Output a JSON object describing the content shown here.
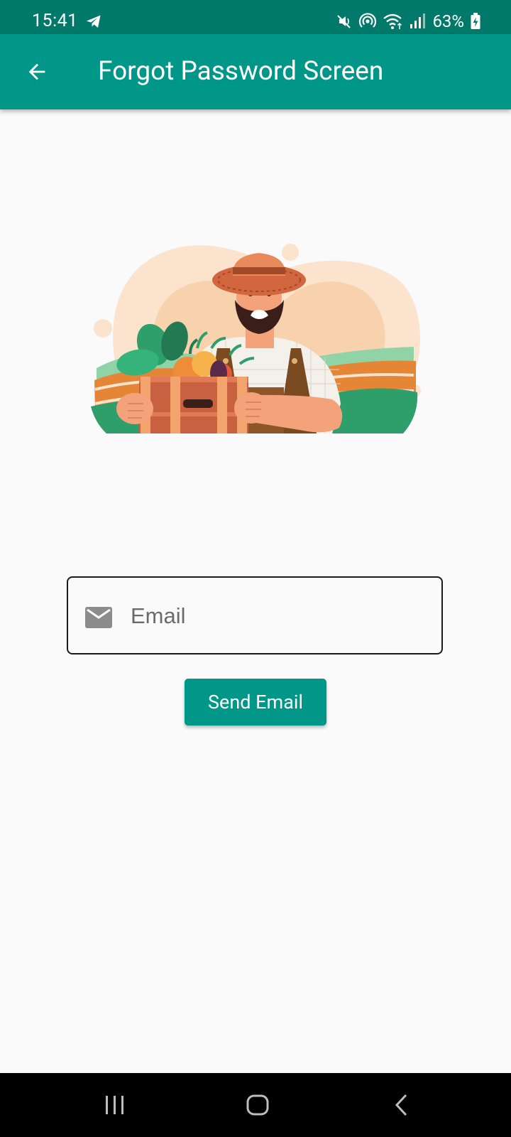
{
  "status_bar": {
    "time": "15:41",
    "battery": "63%",
    "icons": [
      "telegram-icon",
      "mute-icon",
      "hotspot-icon",
      "wifi-icon",
      "signal-icon",
      "battery-charging-icon"
    ]
  },
  "app_bar": {
    "title": "Forgot Password Screen",
    "back_icon": "arrow-back-icon"
  },
  "illustration": {
    "subject": "farmer holding crate of vegetables"
  },
  "form": {
    "email_placeholder": "Email",
    "email_value": "",
    "email_icon": "mail-icon",
    "send_label": "Send Email"
  },
  "nav_bar": {
    "items": [
      "recents-button",
      "home-button",
      "back-button"
    ]
  },
  "colors": {
    "status_bar": "#00796b",
    "app_bar": "#009688",
    "button": "#009688",
    "background": "#fafafa"
  }
}
